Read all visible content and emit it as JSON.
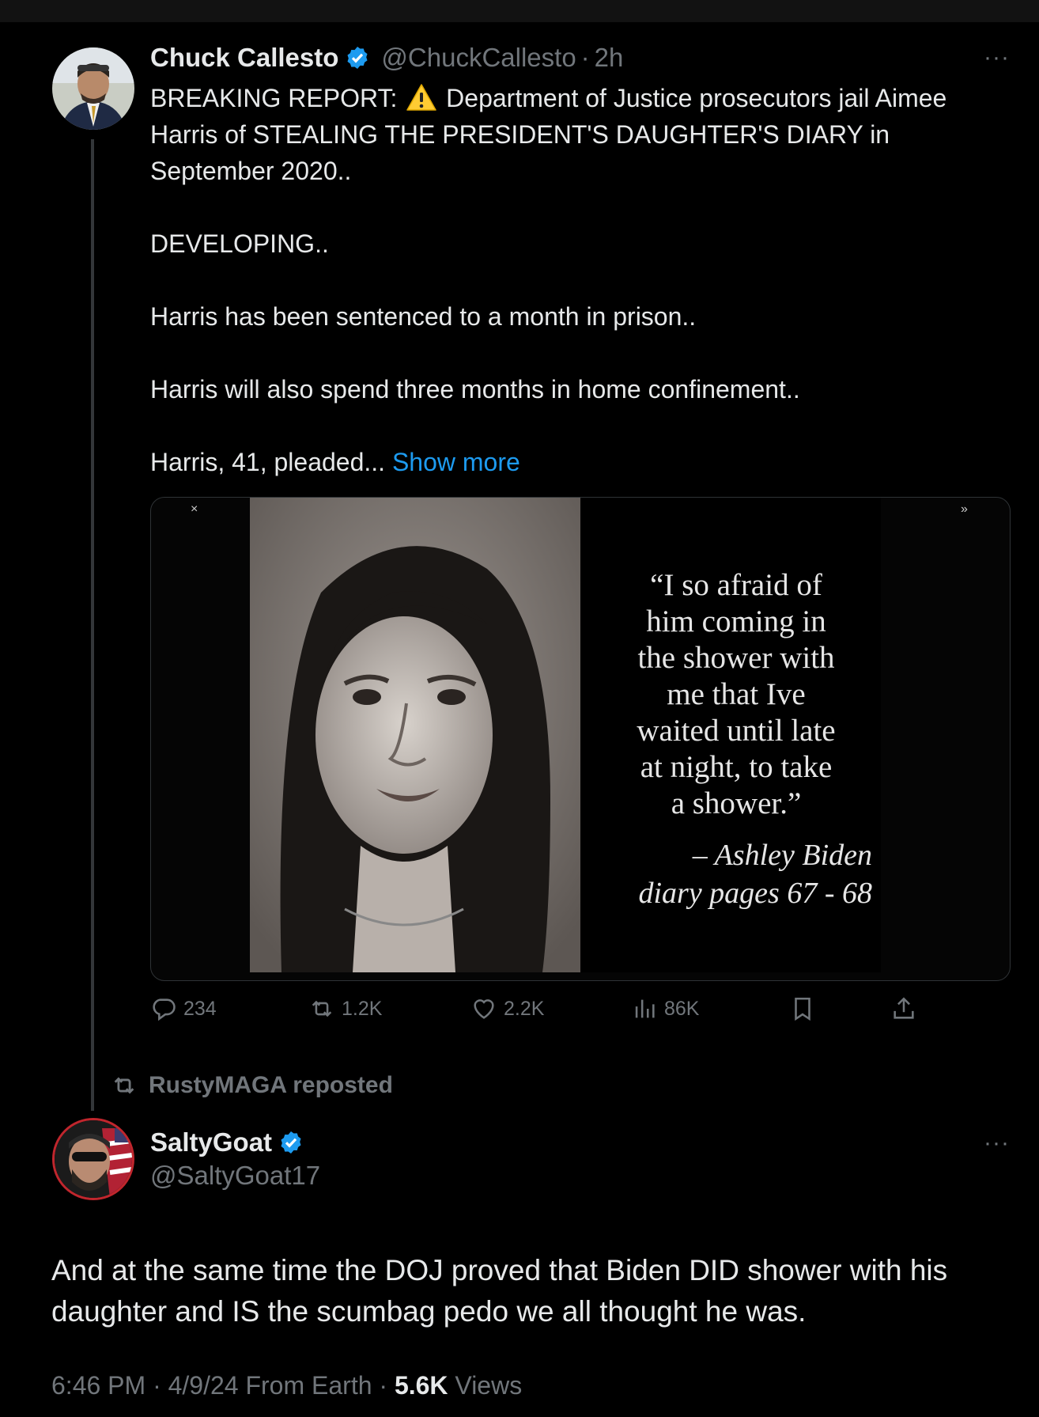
{
  "top_post": {
    "author_name": "Chuck Callesto",
    "handle": "@ChuckCallesto",
    "separator": "·",
    "time": "2h",
    "more": "···",
    "text_line1_a": "BREAKING REPORT: ",
    "text_line1_b": " Department of Justice prosecutors jail Aimee",
    "text_line2": "Harris of STEALING THE PRESIDENT'S DAUGHTER'S DIARY in",
    "text_line3": "September 2020..",
    "text_para2": "DEVELOPING..",
    "text_para3": "Harris has been sentenced to a month in prison..",
    "text_para4": "Harris will also spend three months in home confinement..",
    "text_para5": "Harris, 41, pleaded... ",
    "show_more": "Show more",
    "media": {
      "close_glyph": "×",
      "next_glyph": "»",
      "quote_lines": [
        "“I so afraid of",
        "him coming in",
        "the shower with",
        "me that Ive",
        "waited until late",
        "at night, to take",
        "a shower.”"
      ],
      "attribution_line1": "– Ashley Biden",
      "attribution_line2": "diary pages 67 - 68"
    },
    "actions": {
      "replies": "234",
      "reposts": "1.2K",
      "likes": "2.2K",
      "views": "86K"
    }
  },
  "repost_label": "RustyMAGA reposted",
  "main_post": {
    "author_name": "SaltyGoat",
    "handle": "@SaltyGoat17",
    "more": "···",
    "text": "And at the same time the DOJ proved that Biden DID shower with his daughter and IS the scumbag pedo we all thought he was.",
    "time": "6:46 PM",
    "sep": " · ",
    "date": "4/9/24",
    "source": "From Earth",
    "views_count": "5.6K",
    "views_label": " Views"
  },
  "colors": {
    "background": "#000000",
    "text": "#e7e9ea",
    "muted": "#71767b",
    "link": "#1d9bf0",
    "verified": "#1d9bf0"
  }
}
